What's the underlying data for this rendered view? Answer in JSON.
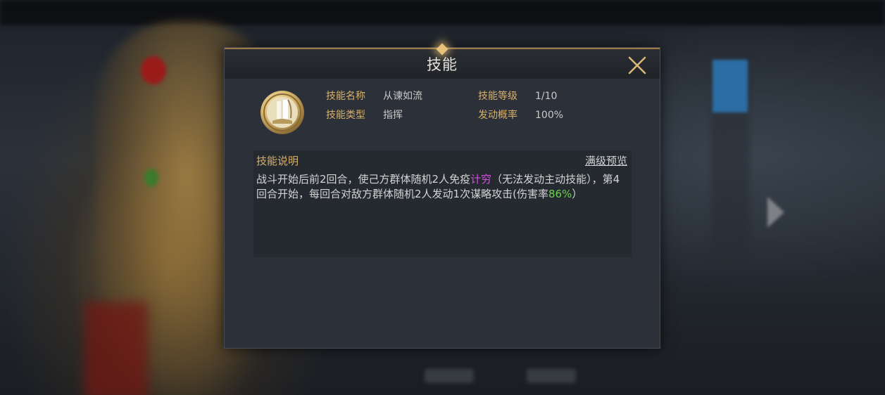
{
  "dialog": {
    "title": "技能",
    "close_icon": "close-x-icon"
  },
  "skill": {
    "icon": "skill-waterfall-emblem-icon",
    "name_label": "技能名称",
    "name_value": "从谏如流",
    "level_label": "技能等级",
    "level_value": "1/10",
    "type_label": "技能类型",
    "type_value": "指挥",
    "chance_label": "发动概率",
    "chance_value": "100%"
  },
  "description": {
    "title": "技能说明",
    "preview_link": "满级预览",
    "text_part1": "战斗开始后前2回合，使己方群体随机2人免疫",
    "highlight_term": "计穷",
    "text_part2": "（无法发动主动技能），第4回合开始，每回合对敌方群体随机2人发动1次谋略攻击(伤害率",
    "highlight_rate": "86%",
    "text_part3": "）"
  },
  "colors": {
    "label_gold": "#d6b06a",
    "highlight_purple": "#d44fe0",
    "highlight_green": "#6cd24f",
    "panel_bg": "#2c3038"
  }
}
